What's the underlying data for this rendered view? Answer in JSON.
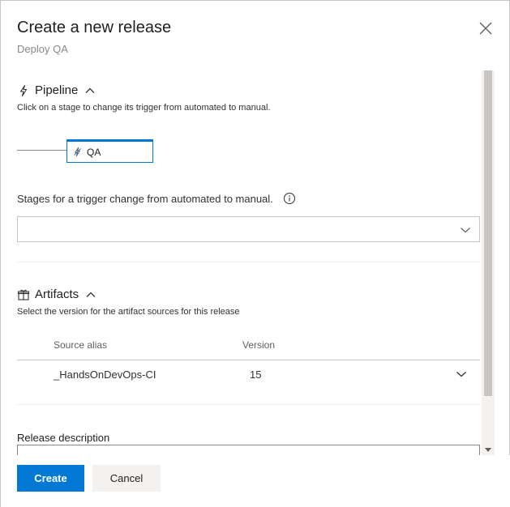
{
  "dialog": {
    "title": "Create a new release",
    "subtitle": "Deploy QA",
    "close_icon": "close-icon"
  },
  "pipeline": {
    "header": "Pipeline",
    "icon": "lightning-icon",
    "description": "Click on a stage to change its trigger from automated to manual.",
    "stages": [
      {
        "name": "QA",
        "icon": "lightning-icon"
      }
    ]
  },
  "trigger_change": {
    "label": "Stages for a trigger change from automated to manual.",
    "value": ""
  },
  "artifacts": {
    "header": "Artifacts",
    "icon": "gift-icon",
    "description": "Select the version for the artifact sources for this release",
    "columns": [
      "Source alias",
      "Version"
    ],
    "rows": [
      {
        "source_alias": "_HandsOnDevOps-CI",
        "version": "15"
      }
    ]
  },
  "release_description": {
    "label": "Release description",
    "value": ""
  },
  "footer": {
    "create_label": "Create",
    "cancel_label": "Cancel"
  },
  "colors": {
    "primary": "#0078d4",
    "cancel_bg": "#f3f2f1",
    "text": "#201f1e"
  }
}
